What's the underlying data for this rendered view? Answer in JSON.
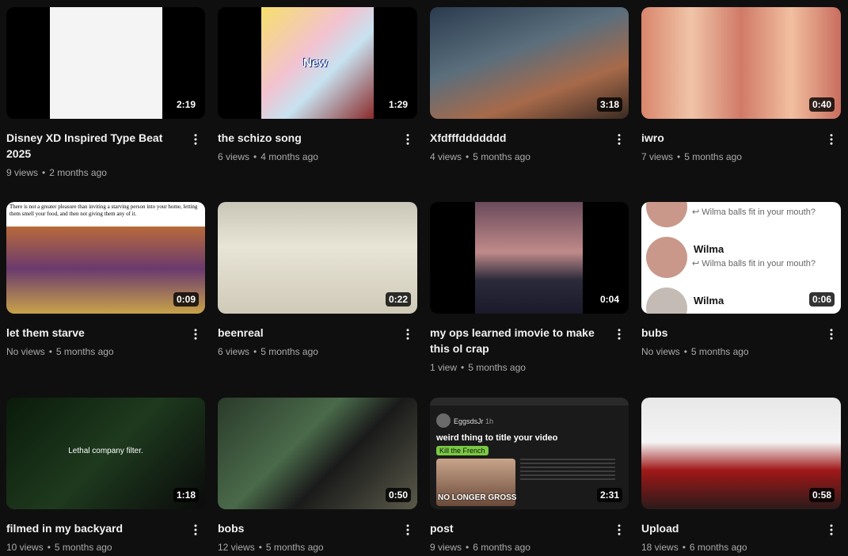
{
  "videos": [
    {
      "title": "Disney XD Inspired Type Beat 2025",
      "duration": "2:19",
      "views": "9 views",
      "age": "2 months ago"
    },
    {
      "title": "the schizo song",
      "duration": "1:29",
      "views": "6 views",
      "age": "4 months ago",
      "thumb_text": "New"
    },
    {
      "title": "Xfdfffddddddd",
      "duration": "3:18",
      "views": "4 views",
      "age": "5 months ago"
    },
    {
      "title": "iwro",
      "duration": "0:40",
      "views": "7 views",
      "age": "5 months ago"
    },
    {
      "title": "let them starve",
      "duration": "0:09",
      "views": "No views",
      "age": "5 months ago",
      "thumb_text": "There is not a greater pleasure than inviting a starving person into your home, letting them smell your food, and then not giving them any of it."
    },
    {
      "title": "beenreal",
      "duration": "0:22",
      "views": "6 views",
      "age": "5 months ago"
    },
    {
      "title": "my ops learned imovie to make this ol crap",
      "duration": "0:04",
      "views": "1 view",
      "age": "5 months ago"
    },
    {
      "title": "bubs",
      "duration": "0:06",
      "views": "No views",
      "age": "5 months ago",
      "thumb_name": "Wilma",
      "thumb_reply": "↩ Wilma balls fit in your mouth?"
    },
    {
      "title": "filmed in my backyard",
      "duration": "1:18",
      "views": "10 views",
      "age": "5 months ago",
      "thumb_text": "Lethal company filter."
    },
    {
      "title": "bobs",
      "duration": "0:50",
      "views": "12 views",
      "age": "5 months ago"
    },
    {
      "title": "post",
      "duration": "2:31",
      "views": "9 views",
      "age": "6 months ago",
      "thumb_user": "EggsdsJr",
      "thumb_time": "1h",
      "thumb_heading": "weird thing to title your video",
      "thumb_tag": "Kill the French",
      "thumb_caption": "NO LONGER GROSS"
    },
    {
      "title": "Upload",
      "duration": "0:58",
      "views": "18 views",
      "age": "6 months ago"
    }
  ],
  "icons": {
    "more": "more-vert-icon"
  },
  "colors": {
    "background": "#0f0f0f",
    "title": "#f1f1f1",
    "meta": "#aaaaaa"
  }
}
